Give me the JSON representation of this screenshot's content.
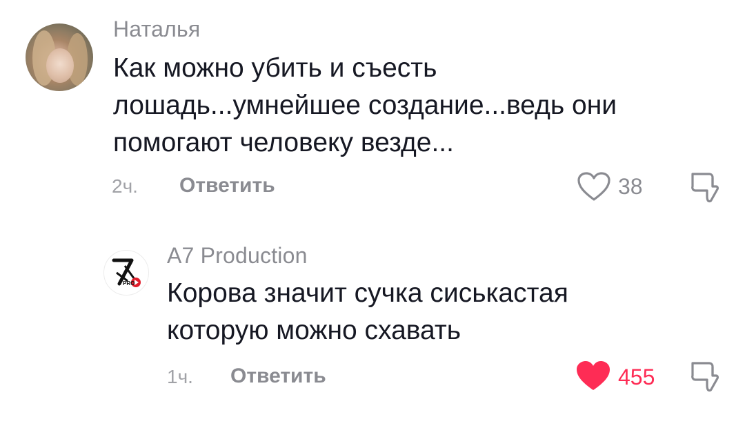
{
  "comments": [
    {
      "username": "Наталья",
      "text_lines": [
        "Как можно убить и съесть",
        "лошадь...умнейшее создание...ведь они",
        "помогают человеку везде..."
      ],
      "time": "2ч.",
      "reply_label": "Ответить",
      "likes": "38",
      "liked": false
    },
    {
      "username": "A7 Production",
      "text_lines": [
        "Корова значит сучка сиськастая",
        "которую можно схавать"
      ],
      "time": "1ч.",
      "reply_label": "Ответить",
      "likes": "455",
      "liked": true,
      "avatar_logo_text": "PRO"
    }
  ],
  "colors": {
    "liked_heart": "#fe2c55",
    "liked_count": "#fe2c55",
    "unliked": "#8a8b91"
  },
  "icons": [
    "heart-outline-icon",
    "heart-filled-icon",
    "dislike-icon"
  ]
}
